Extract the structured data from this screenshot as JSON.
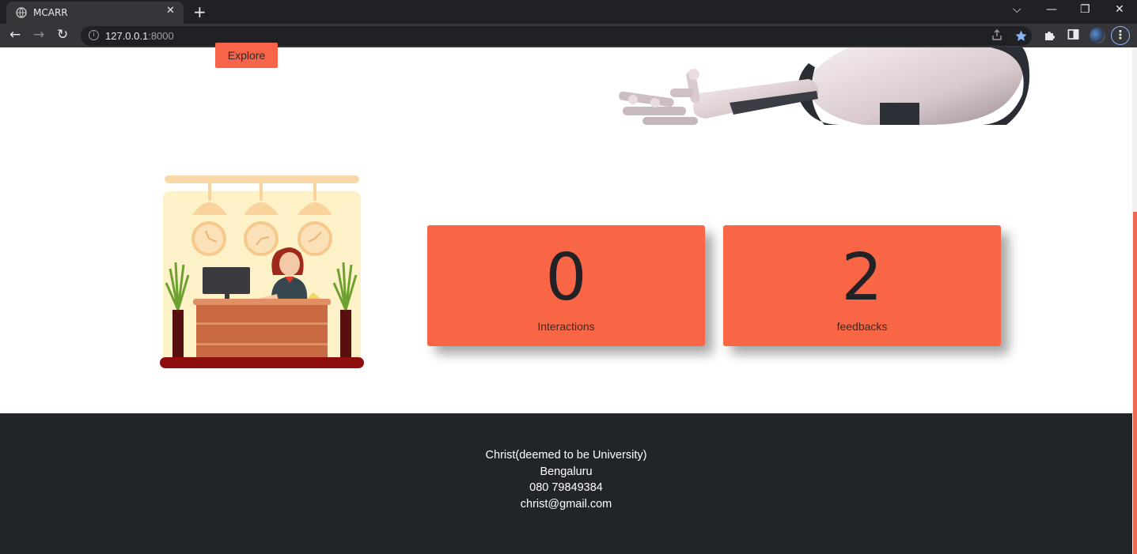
{
  "browser": {
    "tab_title": "MCARR",
    "tab_close": "✕",
    "new_tab": "+",
    "url_host": "127.0.0.1",
    "url_port": ":8000",
    "window_controls": {
      "dropdown": "⌵",
      "minimize": "—",
      "restore": "❐",
      "close": "✕"
    },
    "nav": {
      "back": "←",
      "forward": "→",
      "reload": "↻"
    },
    "icons": [
      "globe-icon",
      "info-icon",
      "share-icon",
      "star-icon",
      "extensions-icon",
      "sidepanel-icon",
      "avatar",
      "menu-icon"
    ],
    "accent_color": "#8ab4f8"
  },
  "hero": {
    "explore_label": "Explore"
  },
  "stats": [
    {
      "value": "0",
      "label": "Interactions"
    },
    {
      "value": "2",
      "label": "feedbacks"
    }
  ],
  "footer": {
    "name": "Christ(deemed to be University)",
    "city": "Bengaluru",
    "phone": "080 79849384",
    "email": "christ@gmail.com"
  },
  "colors": {
    "accent": "#f96645",
    "footer_bg": "#212529"
  }
}
